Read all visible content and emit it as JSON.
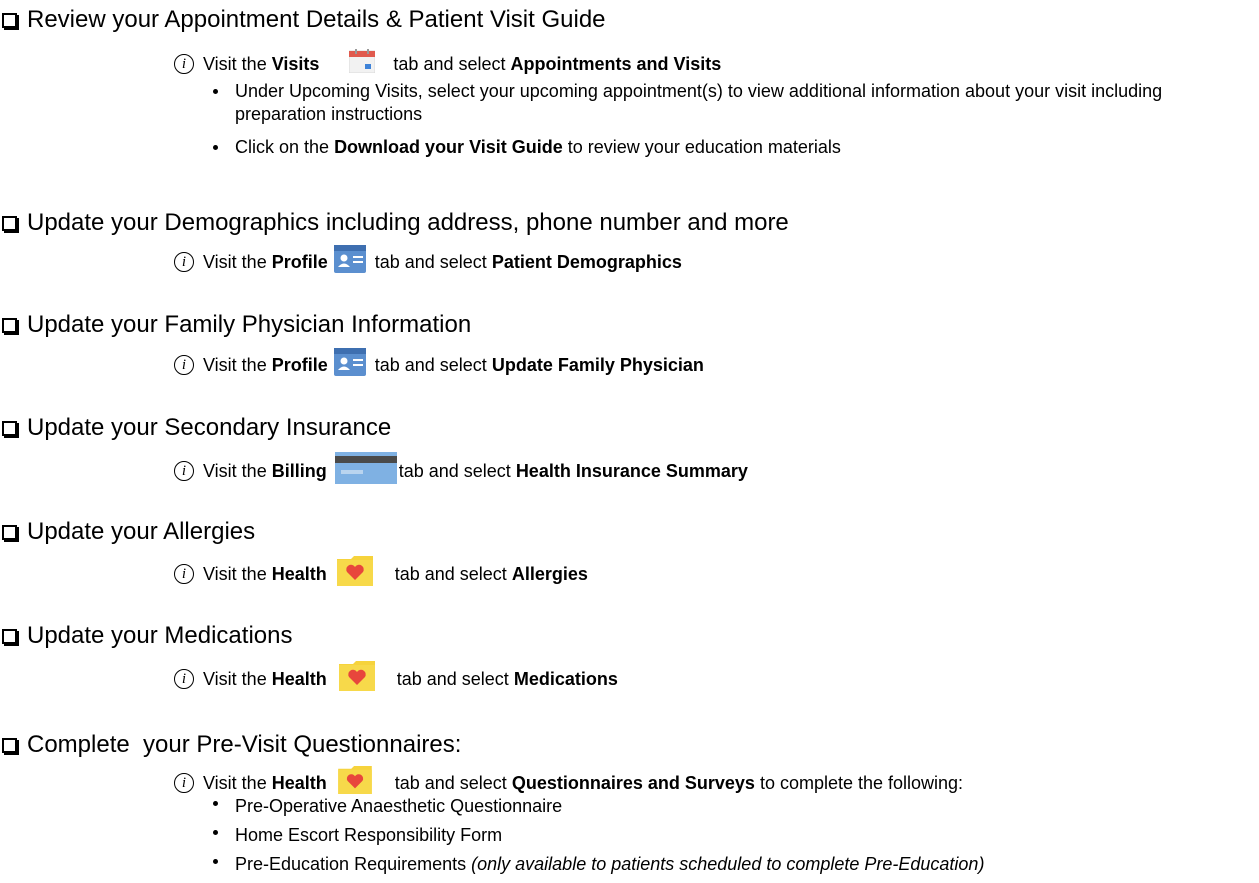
{
  "tasks": [
    {
      "heading": "Review your Appointment Details & Patient Visit Guide",
      "info": {
        "pre": "Visit the",
        "tab": "Visits",
        "tab_icon": "calendar-icon",
        "mid": "tab and select",
        "target": "Appointments and Visits"
      },
      "bullets": [
        {
          "text": "Under Upcoming Visits, select your upcoming appointment(s) to view additional information about your visit including preparation instructions"
        },
        {
          "pre": "Click on the",
          "bold": "Download your Visit Guide",
          "post": "to review your education materials"
        }
      ]
    },
    {
      "heading": "Update your Demographics including address, phone number and more",
      "info": {
        "pre": "Visit the",
        "tab": "Profile",
        "tab_icon": "profile-card-icon",
        "mid": "tab and select",
        "target": "Patient Demographics"
      }
    },
    {
      "heading": "Update your Family Physician Information",
      "info": {
        "pre": "Visit the",
        "tab": "Profile",
        "tab_icon": "profile-card-icon",
        "mid": "tab and select",
        "target": "Update Family Physician"
      }
    },
    {
      "heading": "Update your Secondary Insurance",
      "info": {
        "pre": "Visit the",
        "tab": "Billing",
        "tab_icon": "credit-card-icon",
        "mid": "tab and select",
        "target": "Health Insurance Summary"
      }
    },
    {
      "heading": "Update your Allergies",
      "info": {
        "pre": "Visit the",
        "tab": "Health",
        "tab_icon": "heart-folder-icon",
        "mid": "tab and select",
        "target": "Allergies"
      }
    },
    {
      "heading": "Update your Medications",
      "info": {
        "pre": "Visit the",
        "tab": "Health",
        "tab_icon": "heart-folder-icon",
        "mid": "tab and select",
        "target": "Medications"
      }
    },
    {
      "heading": "Complete  your Pre-Visit Questionnaires:",
      "info": {
        "pre": "Visit the",
        "tab": "Health",
        "tab_icon": "heart-folder-icon",
        "mid": "tab and select",
        "target": "Questionnaires and Surveys",
        "post": "to complete the following:"
      },
      "bullets": [
        {
          "text": "Pre-Operative Anaesthetic Questionnaire"
        },
        {
          "text": "Home Escort Responsibility Form"
        },
        {
          "text": "Pre-Education Requirements",
          "italic": "(only available to patients scheduled to complete Pre-Education)"
        }
      ]
    }
  ],
  "colors": {
    "calendar_red": "#e05a4e",
    "profile_blue": "#5b8fcf",
    "billing_blue": "#6fa8dc",
    "folder_yellow": "#f6d33c",
    "heart_red": "#e8463c"
  }
}
